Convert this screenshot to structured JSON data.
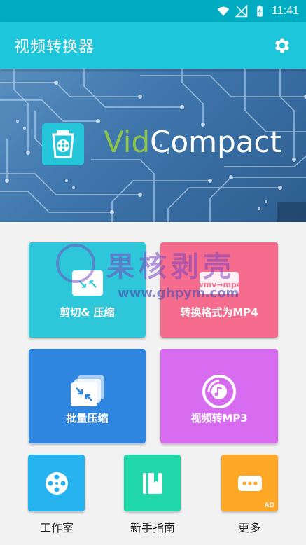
{
  "status_bar": {
    "time": "11:41",
    "icons": [
      "wifi-icon",
      "signal-muted-icon",
      "battery-charging-icon"
    ]
  },
  "app_bar": {
    "title": "视频转换器",
    "settings_icon": "gear-icon"
  },
  "banner": {
    "brand_part1": "Vid",
    "brand_part2": "Compact",
    "logo_icon": "film-compress-icon"
  },
  "cards": [
    {
      "label": "剪切& 压缩",
      "icon": "cut-compress-icon",
      "color": "#2ec7d9"
    },
    {
      "label": "转换格式为MP4",
      "icon": "convert-format-icon",
      "color": "#f56c8e"
    },
    {
      "label": "批量压缩",
      "icon": "batch-compress-icon",
      "color": "#2e86e0"
    },
    {
      "label": "视频转MP3",
      "icon": "music-disc-icon",
      "color": "#d86cf0"
    }
  ],
  "tiles": [
    {
      "label": "工作室",
      "icon": "film-reel-icon",
      "color": "#27b3f0"
    },
    {
      "label": "新手指南",
      "icon": "guide-book-icon",
      "color": "#1fd7a8"
    },
    {
      "label": "更多",
      "icon": "more-dots-icon",
      "color": "#ffa726",
      "badge": "AD"
    }
  ],
  "watermark": {
    "title": "果核剥壳",
    "url": "www.ghpym.com"
  }
}
